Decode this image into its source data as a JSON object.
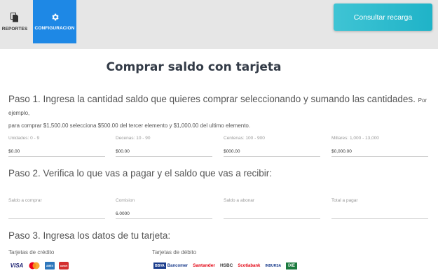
{
  "nav": {
    "reportes_label": "REPORTES",
    "config_label": "CONFIGURACION"
  },
  "header": {
    "consultar_button": "Consultar recarga"
  },
  "title": "Comprar saldo con tarjeta",
  "step1": {
    "text": "Paso 1. Ingresa la cantidad saldo que quieres comprar seleccionando y sumando las cantidades.",
    "hint_a": "Por ejemplo,",
    "hint_b": "para comprar $1,500.00 selecciona $500.00 del tercer elemento y $1,000.00 del ultimo elemento."
  },
  "amount_fields": [
    {
      "label": "Unidades: 0 - 9",
      "value": "$0.00"
    },
    {
      "label": "Decenas: 10 - 90",
      "value": "$00.00"
    },
    {
      "label": "Centenas: 100 - 900",
      "value": "$000.00"
    },
    {
      "label": "Millares: 1,000 - 13,000",
      "value": "$0,000.00"
    }
  ],
  "step2": {
    "text": "Paso 2. Verifica lo que vas a pagar y el saldo que vas a recibir:"
  },
  "summary_fields": [
    {
      "label": "Saldo a comprar",
      "value": ""
    },
    {
      "label": "Comision",
      "value": "6.0000"
    },
    {
      "label": "Saldo a abonar",
      "value": ""
    },
    {
      "label": "Total a pagar",
      "value": ""
    }
  ],
  "step3": {
    "text": "Paso 3. Ingresa los datos de tu tarjeta:"
  },
  "cards": {
    "credit_label": "Tarjetas de crédito",
    "debit_label": "Tarjetas de débito",
    "credit_logos": [
      "VISA",
      "AMEX",
      "carnet"
    ],
    "debit_logos": [
      "BBVA",
      "Bancomer",
      "Santander",
      "HSBC",
      "Scotiabank",
      "INBURSA",
      "IXE"
    ]
  },
  "colors": {
    "primary": "#1e88e5",
    "accent": "#1fb3c8",
    "title": "#333b47"
  }
}
